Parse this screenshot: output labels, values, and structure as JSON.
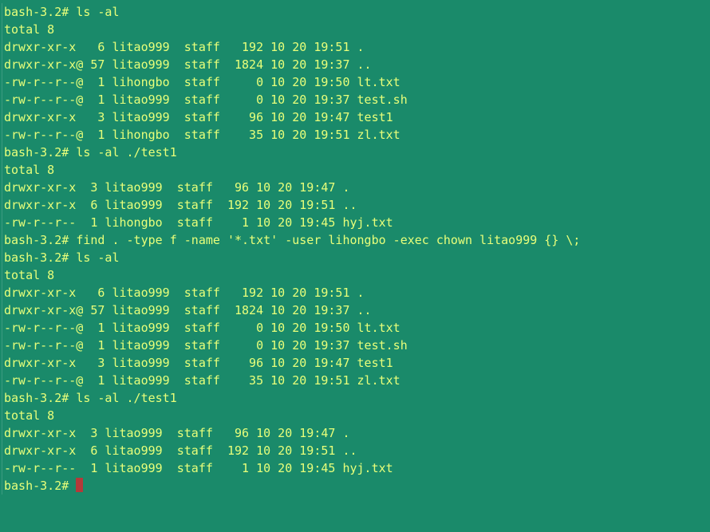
{
  "prompt": "bash-3.2# ",
  "commands": {
    "cmd1": "ls -al",
    "cmd2": "ls -al ./test1",
    "cmd3": "find . -type f -name '*.txt' -user lihongbo -exec chown litao999 {} \\;",
    "cmd4": "ls -al",
    "cmd5": "ls -al ./test1"
  },
  "total": "total 8",
  "listing1": [
    "drwxr-xr-x   6 litao999  staff   192 10 20 19:51 .",
    "drwxr-xr-x@ 57 litao999  staff  1824 10 20 19:37 ..",
    "-rw-r--r--@  1 lihongbo  staff     0 10 20 19:50 lt.txt",
    "-rw-r--r--@  1 litao999  staff     0 10 20 19:37 test.sh",
    "drwxr-xr-x   3 litao999  staff    96 10 20 19:47 test1",
    "-rw-r--r--@  1 lihongbo  staff    35 10 20 19:51 zl.txt"
  ],
  "listing2": [
    "drwxr-xr-x  3 litao999  staff   96 10 20 19:47 .",
    "drwxr-xr-x  6 litao999  staff  192 10 20 19:51 ..",
    "-rw-r--r--  1 lihongbo  staff    1 10 20 19:45 hyj.txt"
  ],
  "listing3": [
    "drwxr-xr-x   6 litao999  staff   192 10 20 19:51 .",
    "drwxr-xr-x@ 57 litao999  staff  1824 10 20 19:37 ..",
    "-rw-r--r--@  1 litao999  staff     0 10 20 19:50 lt.txt",
    "-rw-r--r--@  1 litao999  staff     0 10 20 19:37 test.sh",
    "drwxr-xr-x   3 litao999  staff    96 10 20 19:47 test1",
    "-rw-r--r--@  1 litao999  staff    35 10 20 19:51 zl.txt"
  ],
  "listing4": [
    "drwxr-xr-x  3 litao999  staff   96 10 20 19:47 .",
    "drwxr-xr-x  6 litao999  staff  192 10 20 19:51 ..",
    "-rw-r--r--  1 litao999  staff    1 10 20 19:45 hyj.txt"
  ],
  "blank": ""
}
